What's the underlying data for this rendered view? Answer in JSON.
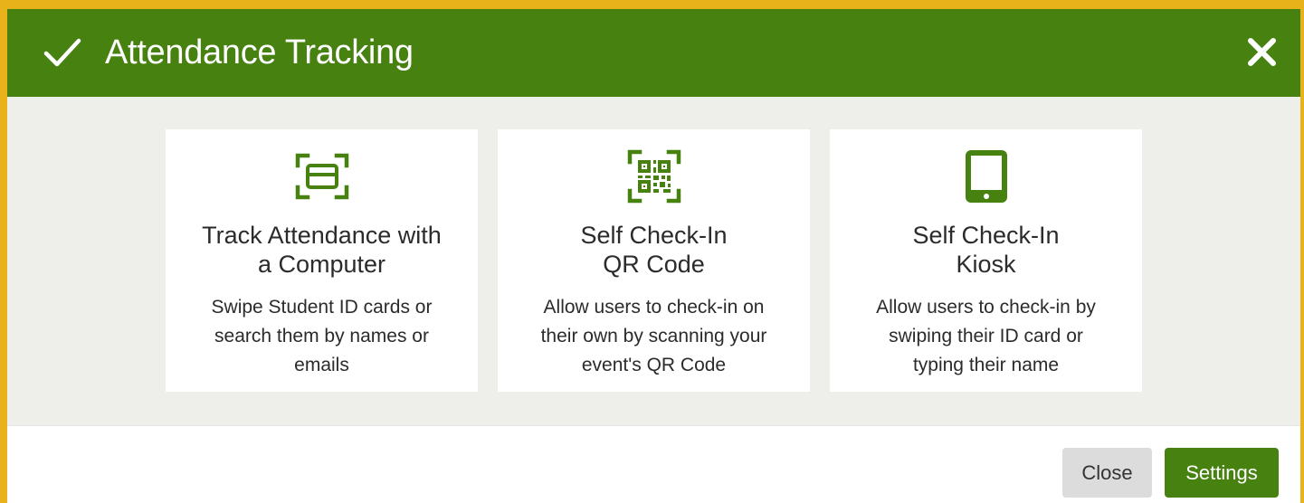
{
  "header": {
    "title": "Attendance Tracking",
    "icon": "check-icon",
    "close_icon": "close-icon"
  },
  "cards": [
    {
      "icon": "card-reader-icon",
      "title_line1": "Track Attendance with",
      "title_line2": "a Computer",
      "desc_line1": "Swipe Student ID cards or",
      "desc_line2": "search them by names or",
      "desc_line3": "emails"
    },
    {
      "icon": "qr-code-icon",
      "title_line1": "Self Check-In",
      "title_line2": "QR Code",
      "desc_line1": "Allow users to check-in on",
      "desc_line2": "their own by scanning your",
      "desc_line3": "event's QR Code"
    },
    {
      "icon": "tablet-icon",
      "title_line1": "Self Check-In",
      "title_line2": "Kiosk",
      "desc_line1": "Allow users to check-in by",
      "desc_line2": "swiping their ID card or",
      "desc_line3": "typing their name"
    }
  ],
  "footer": {
    "close_label": "Close",
    "settings_label": "Settings"
  },
  "colors": {
    "brand_green": "#478211",
    "page_border": "#e8b21a",
    "body_bg": "#eeeeea"
  }
}
